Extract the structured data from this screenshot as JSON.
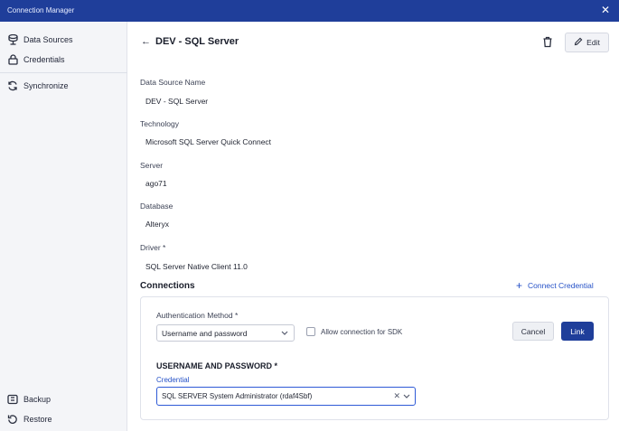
{
  "window": {
    "title": "Connection Manager"
  },
  "sidebar": {
    "items": [
      {
        "label": "Data Sources",
        "icon": "database-icon"
      },
      {
        "label": "Credentials",
        "icon": "lock-icon"
      },
      {
        "label": "Synchronize",
        "icon": "sync-icon"
      }
    ],
    "bottom_items": [
      {
        "label": "Backup",
        "icon": "backup-icon"
      },
      {
        "label": "Restore",
        "icon": "restore-icon"
      }
    ]
  },
  "header": {
    "back_icon": "arrow-left-icon",
    "title": "DEV - SQL Server",
    "delete_icon": "trash-icon",
    "edit_label": "Edit"
  },
  "details": {
    "fields": [
      {
        "label": "Data Source Name",
        "value": "DEV - SQL Server"
      },
      {
        "label": "Technology",
        "value": "Microsoft SQL Server Quick Connect"
      },
      {
        "label": "Server",
        "value": "ago71"
      },
      {
        "label": "Database",
        "value": "Alteryx"
      },
      {
        "label": "Driver *",
        "value": "SQL Server Native Client 11.0"
      }
    ]
  },
  "connections": {
    "title": "Connections",
    "connect_credential_label": "Connect Credential",
    "auth_method_label": "Authentication Method *",
    "auth_method_value": "Username and password",
    "allow_sdk_label": "Allow connection for SDK",
    "allow_sdk_checked": false,
    "cancel_label": "Cancel",
    "link_label": "Link",
    "section_heading": "USERNAME AND PASSWORD *",
    "credential_label": "Credential",
    "credential_value": "SQL SERVER System Administrator (rdaf4Sbf)"
  },
  "colors": {
    "accent": "#1f3e9a",
    "link": "#2551c7",
    "focus_border": "#2e5ad6"
  }
}
